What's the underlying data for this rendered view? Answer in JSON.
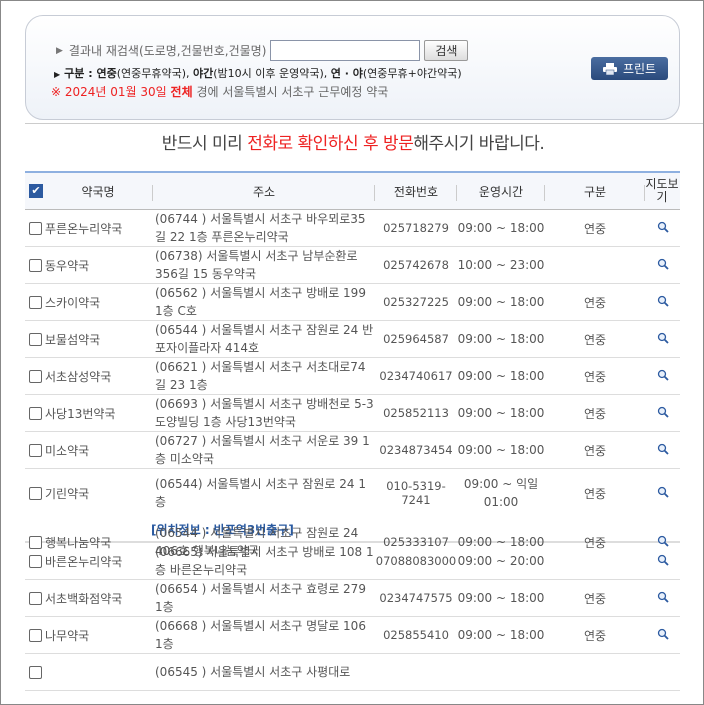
{
  "search": {
    "label": "결과내 재검색(도로명,건물번호,건물명)",
    "value": "",
    "placeholder": "",
    "button_label": "검색"
  },
  "legend": {
    "prefix": "구분 : ",
    "t1": "연중",
    "d1": "(연중무휴약국), ",
    "t2": "야간",
    "d2": "(밤10시 이후 운영약국), ",
    "t3": "연 · 야",
    "d3": "(연중무휴+야간약국)"
  },
  "filter": {
    "mark": "※",
    "date": " 2024년 01월 30일 ",
    "scope": "전체",
    "rest": " 경에  서울특별시  서초구   근무예정 약국"
  },
  "print": {
    "label": "프린트",
    "icon": "printer-icon"
  },
  "notice": {
    "pre": "반드시 미리 ",
    "em": "전화로 확인하신 후 방문",
    "post": "해주시기 바랍니다."
  },
  "table": {
    "headers": {
      "name": "약국명",
      "address": "주소",
      "phone": "전화번호",
      "hours": "운영시간",
      "type": "구분",
      "map": "지도보기"
    },
    "rows": [
      {
        "name": "푸른온누리약국",
        "address": "(06744 ) 서울특별시 서초구 바우뫼로35길 22  1층 푸른온누리약국",
        "phone": "025718279",
        "hours": "09:00 ~ 18:00",
        "type": "연중"
      },
      {
        "name": "동우약국",
        "address": "(06738) 서울특별시 서초구 남부순환로356길 15 동우약국",
        "phone": "025742678",
        "hours": "10:00 ~ 23:00",
        "type": ""
      },
      {
        "name": "스카이약국",
        "address": "(06562 ) 서울특별시 서초구 방배로 199  1층 C호",
        "phone": "025327225",
        "hours": "09:00 ~ 18:00",
        "type": "연중"
      },
      {
        "name": "보물섬약국",
        "address": "(06544 ) 서울특별시 서초구 잠원로 24  반포자이플라자 414호",
        "phone": "025964587",
        "hours": "09:00 ~ 18:00",
        "type": "연중"
      },
      {
        "name": "서초삼성약국",
        "address": "(06621 ) 서울특별시 서초구 서초대로74길 23  1층",
        "phone": "0234740617",
        "hours": "09:00 ~ 18:00",
        "type": "연중"
      },
      {
        "name": "사당13번약국",
        "address": "(06693 ) 서울특별시 서초구 방배천로 5-3  도양빌딩 1층 사당13번약국",
        "phone": "025852113",
        "hours": "09:00 ~ 18:00",
        "type": "연중"
      },
      {
        "name": "미소약국",
        "address": "(06727 ) 서울특별시 서초구 서운로 39  1층 미소약국",
        "phone": "0234873454",
        "hours": "09:00 ~ 18:00",
        "type": "연중"
      },
      {
        "name": "기린약국",
        "address": "(06544) 서울특별시 서초구 잠원로 24 1층",
        "phone": "010-5319-7241",
        "hours": "09:00 ~ 익일 01:00",
        "type": "연중"
      },
      {
        "name": "행복나눔약국",
        "address": "(06544 ) 서울특별시 서초구 잠원로 24  406호 행복나눔약국",
        "phone": "025333107",
        "hours": "09:00 ~ 18:00",
        "type": "연중"
      },
      {
        "name": "바른온누리약국",
        "address": "(06665) 서울특별시 서초구 방배로 108 1층 바른온누리약국",
        "phone": "07088083000",
        "hours": "09:00 ~ 20:00",
        "type": ""
      },
      {
        "name": "서초백화점약국",
        "address": "(06654 ) 서울특별시 서초구 효령로 279  1층",
        "phone": "0234747575",
        "hours": "09:00 ~ 18:00",
        "type": "연중"
      },
      {
        "name": "나무약국",
        "address": "(06668 ) 서울특별시 서초구 명달로 106  1층",
        "phone": "025855410",
        "hours": "09:00 ~ 18:00",
        "type": "연중"
      },
      {
        "name": "",
        "address": "(06545 ) 서울특별시 서초구 사평대로",
        "phone": "",
        "hours": "",
        "type": ""
      }
    ],
    "location_note": "[위치정보 : 반포역3번출구]"
  },
  "colors": {
    "accent": "#2c5aa0",
    "emphasis": "#e22222",
    "header_border": "#8eb0e0"
  },
  "icons": {
    "map": "magnifier-icon",
    "check": "check-icon"
  }
}
